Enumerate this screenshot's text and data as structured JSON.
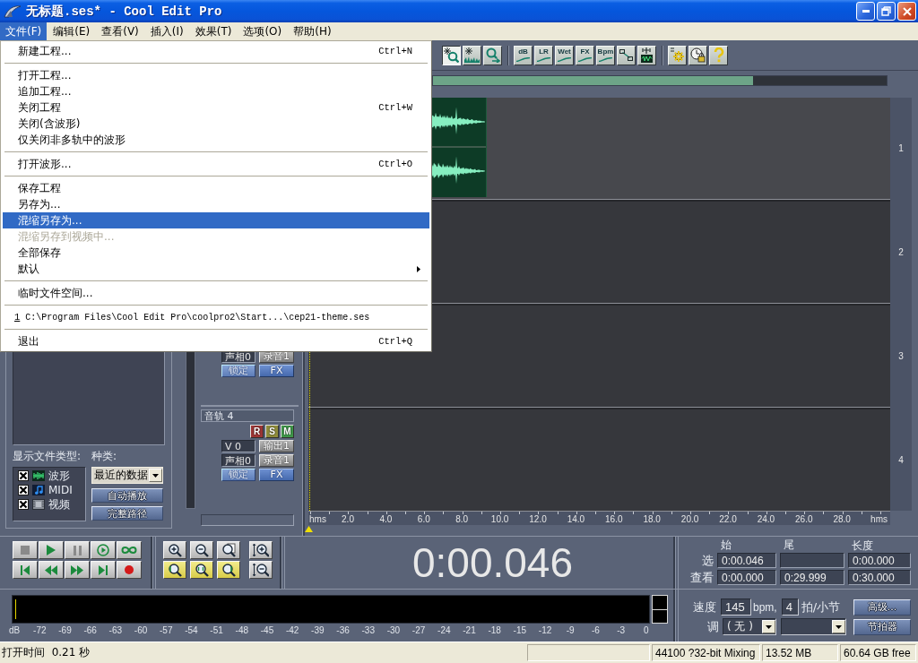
{
  "window": {
    "title": "无标题.ses* - Cool Edit Pro"
  },
  "menu_bar": [
    {
      "label": "文件(F)",
      "selected": true
    },
    {
      "label": "编辑(E)",
      "selected": false
    },
    {
      "label": "查看(V)",
      "selected": false
    },
    {
      "label": "插入(I)",
      "selected": false
    },
    {
      "label": "效果(T)",
      "selected": false
    },
    {
      "label": "选项(O)",
      "selected": false
    },
    {
      "label": "帮助(H)",
      "selected": false
    }
  ],
  "file_menu": [
    {
      "kind": "item",
      "label": "新建工程...",
      "shortcut": "Ctrl+N",
      "selected": false,
      "disabled": false,
      "submenu": false
    },
    {
      "kind": "separator"
    },
    {
      "kind": "item",
      "label": "打开工程...",
      "selected": false,
      "disabled": false,
      "submenu": false
    },
    {
      "kind": "item",
      "label": "追加工程...",
      "selected": false,
      "disabled": false,
      "submenu": false
    },
    {
      "kind": "item",
      "label": "关闭工程",
      "shortcut": "Ctrl+W",
      "selected": false,
      "disabled": false,
      "submenu": false
    },
    {
      "kind": "item",
      "label": "关闭(含波形)",
      "selected": false,
      "disabled": false,
      "submenu": false
    },
    {
      "kind": "item",
      "label": "仅关闭非多轨中的波形",
      "selected": false,
      "disabled": false,
      "submenu": false
    },
    {
      "kind": "separator"
    },
    {
      "kind": "item",
      "label": "打开波形...",
      "shortcut": "Ctrl+O",
      "selected": false,
      "disabled": false,
      "submenu": false
    },
    {
      "kind": "separator"
    },
    {
      "kind": "item",
      "label": "保存工程",
      "selected": false,
      "disabled": false,
      "submenu": false
    },
    {
      "kind": "item",
      "label": "另存为...",
      "selected": false,
      "disabled": false,
      "submenu": false
    },
    {
      "kind": "item",
      "label": "混缩另存为...",
      "selected": true,
      "disabled": false,
      "submenu": false
    },
    {
      "kind": "item",
      "label": "混缩另存到视频中...",
      "selected": false,
      "disabled": true,
      "submenu": false
    },
    {
      "kind": "item",
      "label": "全部保存",
      "selected": false,
      "disabled": false,
      "submenu": false
    },
    {
      "kind": "item",
      "label": "默认",
      "selected": false,
      "disabled": false,
      "submenu": true
    },
    {
      "kind": "separator"
    },
    {
      "kind": "item",
      "label": "临时文件空间...",
      "selected": false,
      "disabled": false,
      "submenu": false
    },
    {
      "kind": "separator"
    },
    {
      "kind": "recent",
      "accelerator": "1",
      "label": "C:\\Program Files\\Cool Edit Pro\\coolpro2\\Start...\\cep21-theme.ses",
      "selected": false,
      "disabled": false,
      "submenu": false
    },
    {
      "kind": "separator"
    },
    {
      "kind": "item",
      "label": "退出",
      "shortcut": "Ctrl+Q",
      "selected": false,
      "disabled": false,
      "submenu": false
    }
  ],
  "toolbar": {
    "groups": [
      {
        "buttons": [
          {
            "kind": "zoom-sparkle",
            "selected": true
          },
          {
            "kind": "sparkle-wave",
            "selected": false
          },
          {
            "kind": "zoom-arrow",
            "selected": false
          }
        ]
      },
      {
        "buttons": [
          {
            "kind": "text",
            "label": "dB",
            "selected": false
          },
          {
            "kind": "text",
            "label": "LR",
            "selected": false
          },
          {
            "kind": "text",
            "label": "Wet",
            "selected": false
          },
          {
            "kind": "text",
            "label": "FX",
            "selected": false
          },
          {
            "kind": "text",
            "label": "Bpm",
            "selected": false
          },
          {
            "kind": "envelope",
            "selected": false
          },
          {
            "kind": "snap",
            "selected": false
          }
        ]
      },
      {
        "buttons": [
          {
            "kind": "gear",
            "selected": false
          },
          {
            "kind": "clock-lock",
            "selected": false
          },
          {
            "kind": "help",
            "selected": false
          }
        ]
      }
    ]
  },
  "file_panel": {
    "types_label": "显示文件类型:",
    "file_types": [
      {
        "kind": "wave",
        "label": "波形",
        "checked": true
      },
      {
        "kind": "midi",
        "label": "MIDI",
        "checked": true
      },
      {
        "kind": "video",
        "label": "视频",
        "checked": true
      }
    ],
    "sort_label": "种类:",
    "sort_value": "最近的数据",
    "buttons": [
      "自动播放",
      "完整路径"
    ]
  },
  "tracks": [
    {
      "number": "1",
      "selected": true,
      "clip": true
    },
    {
      "number": "2",
      "selected": false,
      "clip": false
    },
    {
      "number": "3",
      "selected": false,
      "clip": false,
      "controls": {
        "pan": "声相0",
        "record": "录音1",
        "lock": "锁定",
        "fx": "FX"
      }
    },
    {
      "number": "4",
      "selected": false,
      "clip": false,
      "controls": {
        "name": "音轨 4",
        "toggles": [
          {
            "label": "R",
            "color": "#9c3535"
          },
          {
            "label": "S",
            "color": "#8f8c3c"
          },
          {
            "label": "M",
            "color": "#3f9649"
          }
        ],
        "volume": "V 0",
        "output": "输出1",
        "pan": "声相0",
        "record": "录音1",
        "lock": "锁定",
        "fx": "FX"
      }
    }
  ],
  "ruler": [
    "hms",
    "2.0",
    "4.0",
    "6.0",
    "8.0",
    "10.0",
    "12.0",
    "14.0",
    "16.0",
    "18.0",
    "20.0",
    "22.0",
    "24.0",
    "26.0",
    "28.0",
    "hms"
  ],
  "transport": [
    {
      "kind": "stop"
    },
    {
      "kind": "play"
    },
    {
      "kind": "pause"
    },
    {
      "kind": "play-from-cursor"
    },
    {
      "kind": "loop"
    },
    {
      "kind": "go-to-start"
    },
    {
      "kind": "rewind"
    },
    {
      "kind": "fast-forward"
    },
    {
      "kind": "go-to-end"
    },
    {
      "kind": "record"
    }
  ],
  "zoom": {
    "main": [
      {
        "kind": "zoom-in"
      },
      {
        "kind": "zoom-out"
      },
      {
        "kind": "zoom-full"
      },
      {
        "kind": "zoom-left"
      },
      {
        "kind": "zoom-selection"
      },
      {
        "kind": "zoom-right"
      }
    ],
    "vertical": [
      {
        "kind": "vertical-zoom-in"
      },
      {
        "kind": "vertical-zoom-out"
      }
    ]
  },
  "time_display": "0:00.046",
  "selection": {
    "headers": [
      "始",
      "尾",
      "长度"
    ],
    "rows": [
      {
        "label": "选",
        "begin": "0:00.046",
        "length": "0:00.000"
      },
      {
        "label": "查看",
        "begin": "0:00.000",
        "end": "0:29.999",
        "length": "0:30.000"
      }
    ]
  },
  "meter_scale": [
    "dB",
    "-72",
    "-69",
    "-66",
    "-63",
    "-60",
    "-57",
    "-54",
    "-51",
    "-48",
    "-45",
    "-42",
    "-39",
    "-36",
    "-33",
    "-30",
    "-27",
    "-24",
    "-21",
    "-18",
    "-15",
    "-12",
    "-9",
    "-6",
    "-3",
    "0"
  ],
  "tempo": {
    "tempo_label": "速度",
    "tempo_value": "145",
    "tempo_unit": "bpm,",
    "beats_value": "4",
    "beats_label": "拍/小节",
    "advanced_button": "高级...",
    "key_label": "调",
    "key_value": "( 无 )",
    "metronome_button": "节拍器"
  },
  "status_bar": {
    "message": "打开时间  0.21 秒",
    "panels": [
      "44100 ?32-bit Mixing",
      "13.52 MB",
      "60.64 GB free"
    ]
  }
}
